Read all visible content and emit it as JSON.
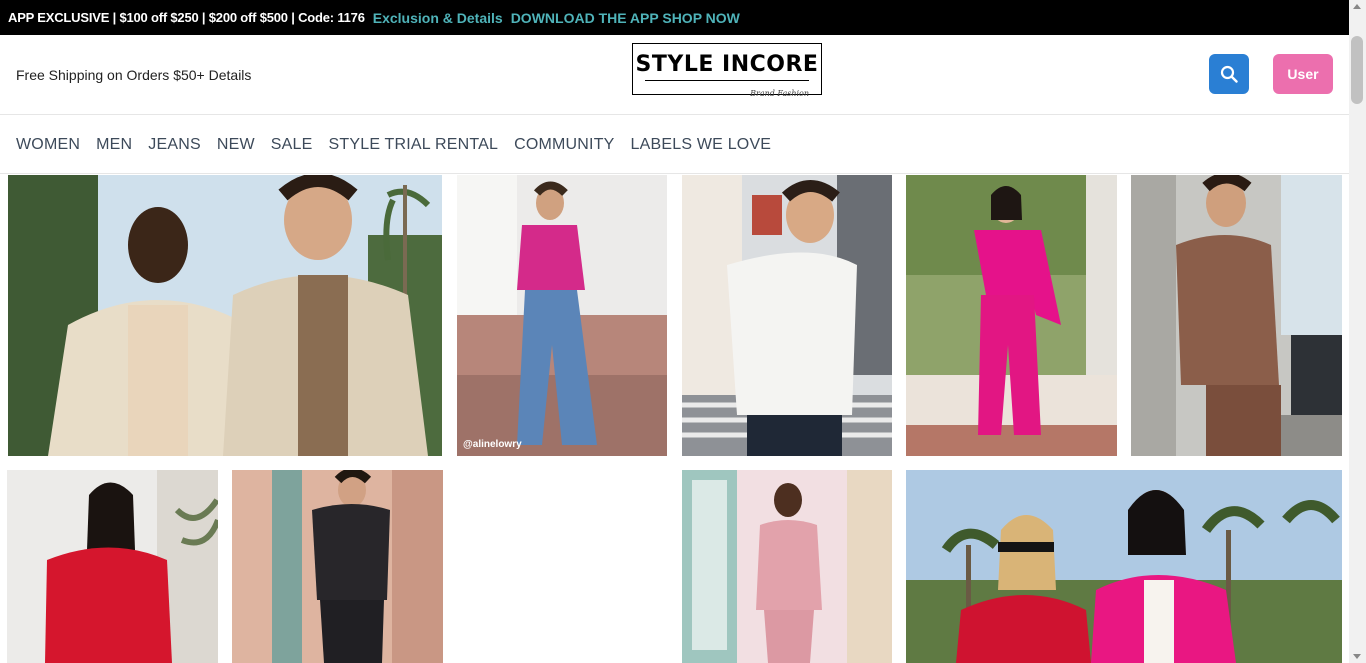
{
  "promo": {
    "text": "APP EXCLUSIVE | $100 off $250 | $200 off $500 | Code: 1176",
    "details_link": "Exclusion & Details",
    "download_link": "DOWNLOAD THE APP SHOP NOW",
    "link_color": "#4fb3b9"
  },
  "header": {
    "shipping_text": "Free Shipping on Orders $50+ Details",
    "logo_text": "STYLE INCORE",
    "logo_tagline": "Brand Fashion",
    "search_icon": "search-icon",
    "user_label": "User",
    "search_color": "#2a7fd4",
    "user_color": "#ec6fae"
  },
  "nav": {
    "items": [
      "WOMEN",
      "MEN",
      "JEANS",
      "NEW",
      "SALE",
      "STYLE TRIAL RENTAL",
      "COMMUNITY",
      "LABELS WE LOVE"
    ]
  },
  "gallery": {
    "photo_credit": "@alinelowry"
  }
}
